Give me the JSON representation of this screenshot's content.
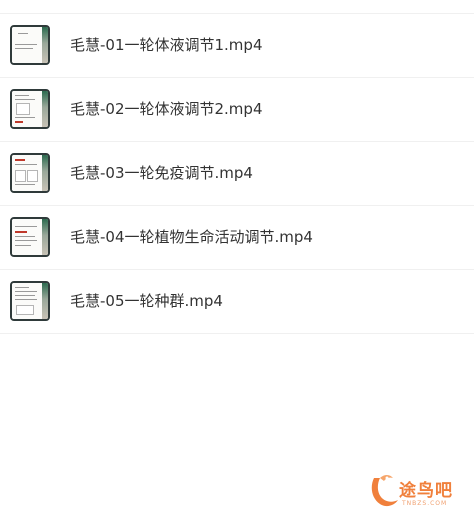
{
  "files": [
    {
      "name": "毛慧-01一轮体液调节1.mp4",
      "thumbnail": "video-thumbnail"
    },
    {
      "name": "毛慧-02一轮体液调节2.mp4",
      "thumbnail": "video-thumbnail"
    },
    {
      "name": "毛慧-03一轮免疫调节.mp4",
      "thumbnail": "video-thumbnail"
    },
    {
      "name": "毛慧-04一轮植物生命活动调节.mp4",
      "thumbnail": "video-thumbnail"
    },
    {
      "name": "毛慧-05一轮种群.mp4",
      "thumbnail": "video-thumbnail"
    }
  ],
  "watermark": {
    "text": "途鸟吧",
    "subtext": "TNBZS.COM",
    "color": "#f0803c"
  }
}
